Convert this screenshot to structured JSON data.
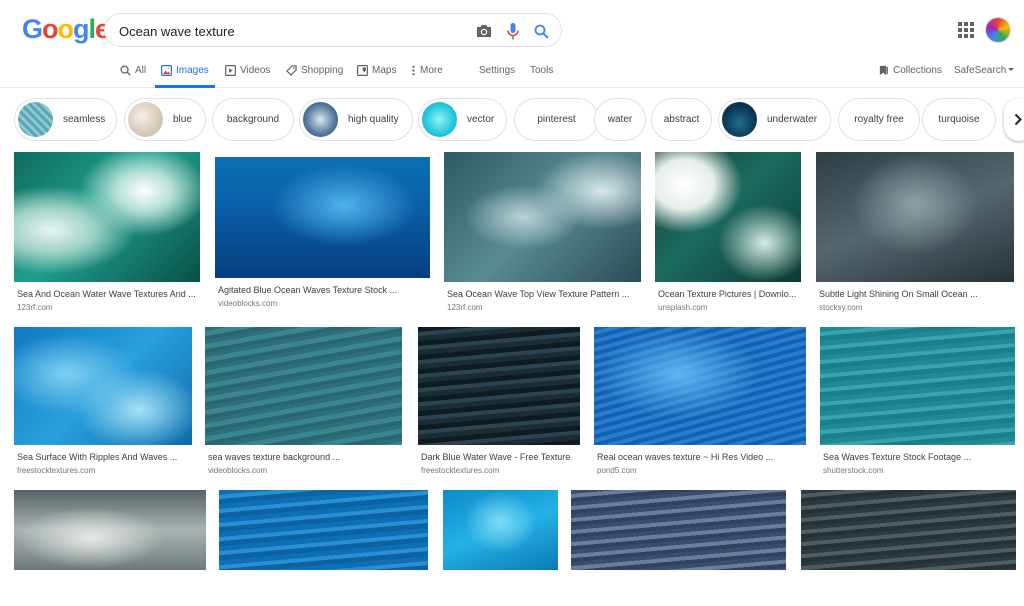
{
  "search": {
    "query": "Ocean wave texture",
    "logo_letters": [
      "G",
      "o",
      "o",
      "g",
      "l",
      "e"
    ],
    "logo_colors": [
      "#4285f4",
      "#ea4335",
      "#fbbc05",
      "#4285f4",
      "#34a853",
      "#ea4335"
    ]
  },
  "tabs": [
    {
      "label": "All",
      "icon": "search-icon"
    },
    {
      "label": "Images",
      "icon": "image-icon",
      "active": true
    },
    {
      "label": "Videos",
      "icon": "video-icon"
    },
    {
      "label": "Shopping",
      "icon": "tag-icon"
    },
    {
      "label": "Maps",
      "icon": "map-icon"
    },
    {
      "label": "More",
      "icon": "more-vert-icon"
    },
    {
      "label": "Settings"
    },
    {
      "label": "Tools"
    }
  ],
  "right_tabs": {
    "collections": "Collections",
    "safesearch": "SafeSearch"
  },
  "chips": [
    {
      "label": "seamless",
      "thumb": true
    },
    {
      "label": "blue",
      "thumb": true
    },
    {
      "label": "background",
      "thumb": false
    },
    {
      "label": "high quality",
      "thumb": true
    },
    {
      "label": "vector",
      "thumb": true
    },
    {
      "label": "pinterest",
      "thumb": false
    },
    {
      "label": "water",
      "thumb": false
    },
    {
      "label": "abstract",
      "thumb": false
    },
    {
      "label": "underwater",
      "thumb": true
    },
    {
      "label": "royalty free",
      "thumb": false
    },
    {
      "label": "turquoise",
      "thumb": false
    }
  ],
  "results": [
    {
      "title": "Sea And Ocean Water Wave Textures And ...",
      "source": "123rf.com"
    },
    {
      "title": "Agitated Blue Ocean Waves Texture Stock ...",
      "source": "videoblocks.com"
    },
    {
      "title": "Sea Ocean Wave Top View Texture Pattern ...",
      "source": "123rf.com"
    },
    {
      "title": "Ocean Texture Pictures | Downlo...",
      "source": "unsplash.com"
    },
    {
      "title": "Subtle Light Shining On Small Ocean ...",
      "source": "stocksy.com"
    },
    {
      "title": "Sea Surface With Ripples And Waves ...",
      "source": "freestocktextures.com"
    },
    {
      "title": "sea waves texture background ...",
      "source": "videoblocks.com"
    },
    {
      "title": "Dark Blue Water Wave - Free Texture",
      "source": "freestocktextures.com"
    },
    {
      "title": "Real ocean waves texture ~ Hi Res Video ...",
      "source": "pond5.com"
    },
    {
      "title": "Sea Waves Texture Stock Footage ...",
      "source": "shutterstock.com"
    },
    {
      "title": "",
      "source": ""
    },
    {
      "title": "",
      "source": ""
    },
    {
      "title": "",
      "source": ""
    },
    {
      "title": "",
      "source": ""
    },
    {
      "title": "",
      "source": ""
    }
  ],
  "colors": {
    "accent": "#1a73e8",
    "muted": "#5f6368",
    "border": "#dfe1e5"
  }
}
